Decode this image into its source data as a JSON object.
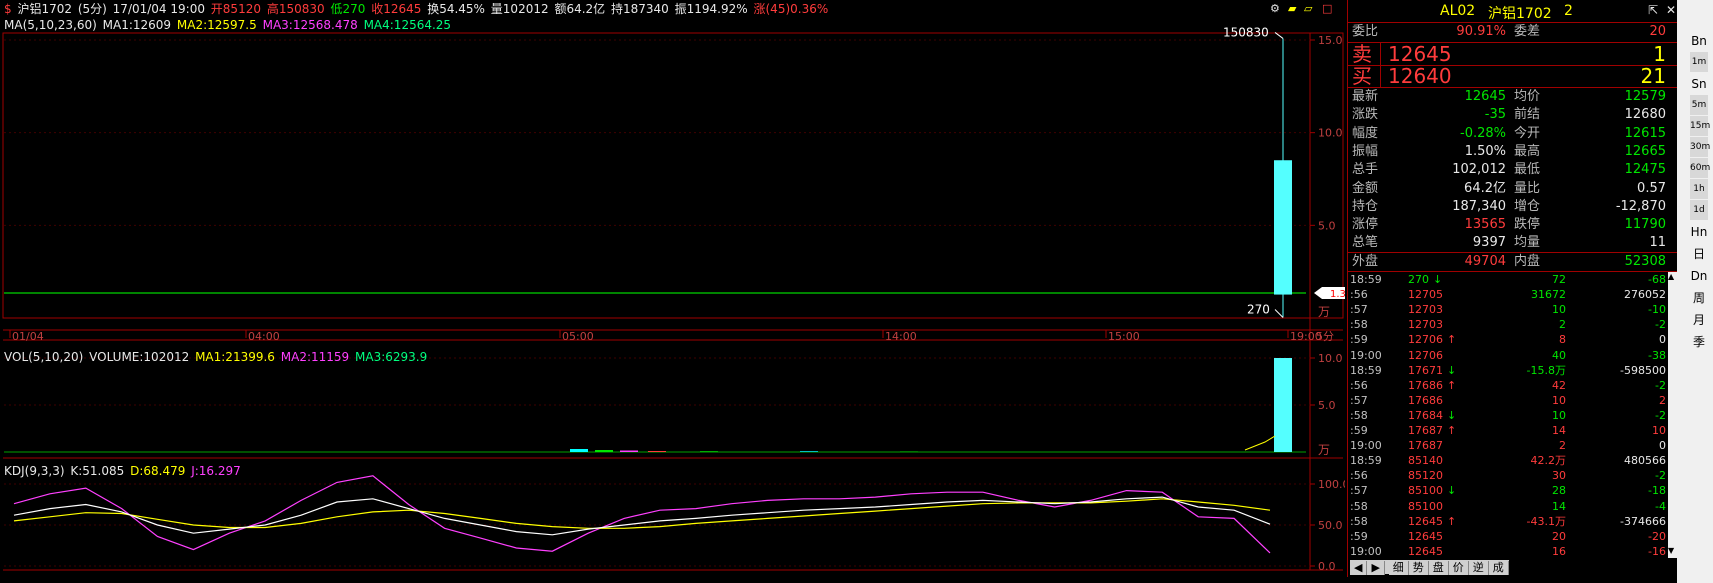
{
  "top_bar": {
    "symbol": "沪铝1702",
    "period": "(5分)",
    "datetime": "17/01/04 19:00",
    "open": "开85120",
    "high": "高150830",
    "low": "低270",
    "close": "收12645",
    "turnover": "换54.45%",
    "volume": "量102012",
    "amount": "额64.2亿",
    "hold": "持187340",
    "amplitude": "振1194.92%",
    "change": "涨(45)0.36%"
  },
  "ma_bar": {
    "label": "MA(5,10,23,60)",
    "ma1": "MA1:12609",
    "ma2": "MA2:12597.5",
    "ma3": "MA3:12568.478",
    "ma4": "MA4:12564.25"
  },
  "vol_bar": {
    "label": "VOL(5,10,20)",
    "volume": "VOLUME:102012",
    "ma1": "MA1:21399.6",
    "ma2": "MA2:11159",
    "ma3": "MA3:6293.9"
  },
  "kdj_bar": {
    "label": "KDJ(9,3,3)",
    "k": "K:51.085",
    "d": "D:68.479",
    "j": "J:16.297"
  },
  "chart_data": {
    "type": "candlestick",
    "price_axis": [
      "15.0",
      "10.0",
      "5.0"
    ],
    "price_axis_unit": "万",
    "high_label": "150830",
    "low_label": "270",
    "last_marker": "1.3",
    "time_labels": [
      "01/04",
      "04:00",
      "05:00",
      "14:00",
      "15:00",
      "19:00"
    ],
    "period_label": "5分",
    "last_candle": {
      "open": 85120,
      "high": 150830,
      "low": 270,
      "close": 12645
    },
    "base_line": 12645,
    "vol_axis": [
      "10.0",
      "5.0"
    ],
    "vol_axis_unit": "万",
    "kdj_axis": [
      "100.0",
      "50.0",
      "0.0"
    ],
    "kdj": {
      "K": [
        62,
        70,
        75,
        66,
        50,
        40,
        45,
        50,
        62,
        78,
        82,
        70,
        58,
        50,
        42,
        38,
        45,
        50,
        55,
        58,
        62,
        65,
        68,
        70,
        72,
        75,
        78,
        80,
        78,
        76,
        78,
        82,
        84,
        72,
        68,
        51
      ],
      "D": [
        55,
        60,
        65,
        64,
        57,
        50,
        47,
        47,
        52,
        60,
        66,
        68,
        64,
        58,
        52,
        48,
        46,
        46,
        48,
        52,
        55,
        58,
        61,
        64,
        67,
        70,
        73,
        76,
        77,
        77,
        77,
        79,
        82,
        78,
        74,
        68
      ],
      "J": [
        76,
        88,
        95,
        70,
        36,
        20,
        40,
        55,
        80,
        102,
        110,
        75,
        46,
        34,
        22,
        18,
        40,
        58,
        68,
        70,
        76,
        80,
        82,
        82,
        84,
        88,
        90,
        90,
        80,
        72,
        80,
        92,
        90,
        60,
        58,
        16
      ]
    }
  },
  "quote": {
    "header_code": "AL02",
    "header_name": "沪铝1702",
    "header_num": "2",
    "weibi_label": "委比",
    "weibi_val": "90.91%",
    "weicha_label": "委差",
    "weicha_val": "20",
    "sell_label": "卖",
    "sell_price": "12645",
    "sell_vol": "1",
    "buy_label": "买",
    "buy_price": "12640",
    "buy_vol": "21",
    "rows": [
      {
        "l1": "最新",
        "v1": "12645",
        "c1": "green",
        "l2": "均价",
        "v2": "12579",
        "c2": "green"
      },
      {
        "l1": "涨跌",
        "v1": "-35",
        "c1": "green",
        "l2": "前结",
        "v2": "12680",
        "c2": "white"
      },
      {
        "l1": "幅度",
        "v1": "-0.28%",
        "c1": "green",
        "l2": "今开",
        "v2": "12615",
        "c2": "green"
      },
      {
        "l1": "振幅",
        "v1": "1.50%",
        "c1": "white",
        "l2": "最高",
        "v2": "12665",
        "c2": "green"
      },
      {
        "l1": "总手",
        "v1": "102,012",
        "c1": "white",
        "l2": "最低",
        "v2": "12475",
        "c2": "green"
      },
      {
        "l1": "金额",
        "v1": "64.2亿",
        "c1": "white",
        "l2": "量比",
        "v2": "0.57",
        "c2": "white"
      },
      {
        "l1": "持仓",
        "v1": "187,340",
        "c1": "white",
        "l2": "增仓",
        "v2": "-12,870",
        "c2": "white"
      },
      {
        "l1": "涨停",
        "v1": "13565",
        "c1": "red",
        "l2": "跌停",
        "v2": "11790",
        "c2": "green"
      },
      {
        "l1": "总笔",
        "v1": "9397",
        "c1": "white",
        "l2": "均量",
        "v2": "11",
        "c2": "white"
      }
    ],
    "outer_label": "外盘",
    "outer_val": "49704",
    "inner_label": "内盘",
    "inner_val": "52308",
    "ticks": [
      {
        "t": "18:59",
        "p": "270",
        "a": "↓",
        "v": "72",
        "d": "-68",
        "pc": "green",
        "vc": "green",
        "dc": "green"
      },
      {
        "t": ":56",
        "p": "12705",
        "a": "",
        "v": "31672",
        "d": "276052",
        "pc": "red",
        "vc": "green",
        "dc": "white"
      },
      {
        "t": ":57",
        "p": "12703",
        "a": "",
        "v": "10",
        "d": "-10",
        "pc": "red",
        "vc": "green",
        "dc": "green"
      },
      {
        "t": ":58",
        "p": "12703",
        "a": "",
        "v": "2",
        "d": "-2",
        "pc": "red",
        "vc": "green",
        "dc": "green"
      },
      {
        "t": ":59",
        "p": "12706",
        "a": "↑",
        "v": "8",
        "d": "0",
        "pc": "red",
        "vc": "red",
        "dc": "white"
      },
      {
        "t": "19:00",
        "p": "12706",
        "a": "",
        "v": "40",
        "d": "-38",
        "pc": "red",
        "vc": "green",
        "dc": "green"
      },
      {
        "t": "18:59",
        "p": "17671",
        "a": "↓",
        "v": "-15.8万",
        "d": "-598500",
        "pc": "red",
        "vc": "green",
        "dc": "white"
      },
      {
        "t": ":56",
        "p": "17686",
        "a": "↑",
        "v": "42",
        "d": "-2",
        "pc": "red",
        "vc": "red",
        "dc": "green"
      },
      {
        "t": ":57",
        "p": "17686",
        "a": "",
        "v": "10",
        "d": "2",
        "pc": "red",
        "vc": "red",
        "dc": "red"
      },
      {
        "t": ":58",
        "p": "17684",
        "a": "↓",
        "v": "10",
        "d": "-2",
        "pc": "red",
        "vc": "green",
        "dc": "green"
      },
      {
        "t": ":59",
        "p": "17687",
        "a": "↑",
        "v": "14",
        "d": "10",
        "pc": "red",
        "vc": "red",
        "dc": "red"
      },
      {
        "t": "19:00",
        "p": "17687",
        "a": "",
        "v": "2",
        "d": "0",
        "pc": "red",
        "vc": "red",
        "dc": "white"
      },
      {
        "t": "18:59",
        "p": "85140",
        "a": "",
        "v": "42.2万",
        "d": "480566",
        "pc": "red",
        "vc": "red",
        "dc": "white"
      },
      {
        "t": ":56",
        "p": "85120",
        "a": "",
        "v": "30",
        "d": "-2",
        "pc": "red",
        "vc": "red",
        "dc": "green"
      },
      {
        "t": ":57",
        "p": "85100",
        "a": "↓",
        "v": "28",
        "d": "-18",
        "pc": "red",
        "vc": "green",
        "dc": "green"
      },
      {
        "t": ":58",
        "p": "85100",
        "a": "",
        "v": "14",
        "d": "-4",
        "pc": "red",
        "vc": "green",
        "dc": "green"
      },
      {
        "t": ":58",
        "p": "12645",
        "a": "↑",
        "v": "-43.1万",
        "d": "-374666",
        "pc": "red",
        "vc": "red",
        "dc": "white"
      },
      {
        "t": ":59",
        "p": "12645",
        "a": "",
        "v": "20",
        "d": "-20",
        "pc": "red",
        "vc": "red",
        "dc": "red"
      },
      {
        "t": "19:00",
        "p": "12645",
        "a": "",
        "v": "16",
        "d": "-16",
        "pc": "red",
        "vc": "red",
        "dc": "red"
      }
    ],
    "bottom_tabs": [
      "细",
      "势",
      "盘",
      "价",
      "逆",
      "成"
    ]
  },
  "side_buttons": [
    "1m",
    "5m",
    "15m",
    "30m",
    "60m",
    "1h",
    "1d"
  ],
  "side_labels": [
    "Bn",
    "Sn",
    "Hn",
    "日",
    "Dn",
    "周",
    "月",
    "季"
  ],
  "colors": {
    "up": "#ff3c3c",
    "down": "#00e600",
    "candle": "#54ffff",
    "grid": "#a00000"
  }
}
